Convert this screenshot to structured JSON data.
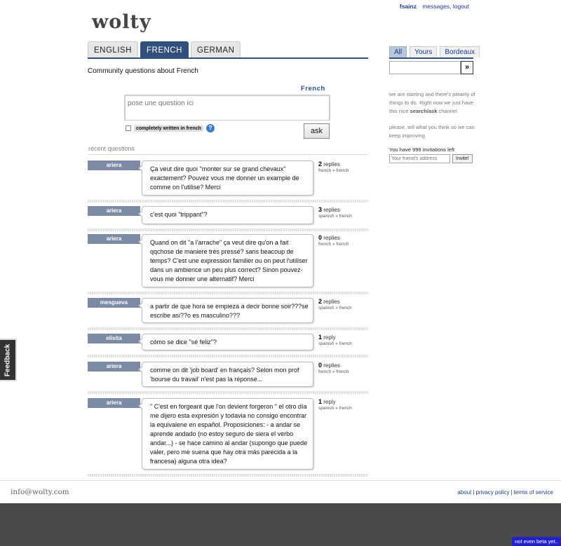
{
  "header": {
    "user": "fsainz",
    "messages_link": "messages",
    "logout_link": "logout",
    "logo": "wolty"
  },
  "tabs": [
    {
      "label": "ENGLISH",
      "active": false
    },
    {
      "label": "FRENCH",
      "active": true
    },
    {
      "label": "GERMAN",
      "active": false
    }
  ],
  "sidebar": {
    "tabs": [
      {
        "label": "All",
        "active": true
      },
      {
        "label": "Yours",
        "active": false
      },
      {
        "label": "Bordeaux",
        "active": false
      }
    ],
    "search_button": "»",
    "intro_text_1": "we are starting and there's pleanty of things to do. Right now we just have this nice ",
    "intro_highlight": "search/ask",
    "intro_text_2": " channel",
    "feedback_text": "please, tell what you think so we can keep improving",
    "invitations_text": "You have 998 invitations left",
    "invite_placeholder": "Your friend's address",
    "invite_button": "Invite!"
  },
  "main": {
    "title": "Community questions about French",
    "language_label": "French",
    "question_placeholder": "pose une question ici",
    "written_label": "completely written in french",
    "help_icon": "?",
    "ask_button": "ask",
    "recent_label": "recent questions"
  },
  "questions": [
    {
      "user": "ariera",
      "text": "Ça veut dire quoi \"monter sur se grand chevaux\" exactement? Pouvez vous me donner un example de comme on l'utilise? Merci",
      "replies": "2",
      "replies_label": "replies",
      "pair": "french » french"
    },
    {
      "user": "ariera",
      "text": "c'est quoi \"trippant\"?",
      "replies": "3",
      "replies_label": "replies",
      "pair": "spanish » french"
    },
    {
      "user": "ariera",
      "text": "Quand on dit \"a l'arrache\" ça veut dire qu'on a fait qqchose de maniere très pressé? sans beacoup de temps? C'est une expression familier ou on peut l'utiliser dans un ambience un peu plus correct? Sinon pouvez-vous me donner une alternatif? Merci",
      "replies": "0",
      "replies_label": "replies",
      "pair": "french » french"
    },
    {
      "user": "mesgueva",
      "text": "a partir de que hora se empieza a decir bonne soir???se escribe asi??o es masculino???",
      "replies": "2",
      "replies_label": "replies",
      "pair": "spanish » french"
    },
    {
      "user": "elisita",
      "text": "cómo se dice \"sé feliz\"?",
      "replies": "1",
      "replies_label": "reply",
      "pair": "spanish » french"
    },
    {
      "user": "ariera",
      "text": "comme on dit 'job board' en français? Selon mon prof 'bourse du travail' n'est pas la réponse...",
      "replies": "0",
      "replies_label": "replies",
      "pair": "french » french"
    },
    {
      "user": "ariera",
      "text": "\" C'est en forgeant que l'on devient forgeron \" el otro día me dijero esta expresión y todavia no consigo encontrar la equivalene en español. Proposiciones: - a andar se aprende andado (no estoy seguro de siera el verbo andar...) - se hace camino al andar (supongo que puede valer, pero me suena que hay otra más parecida a la francesa) alguna otra idea?",
      "replies": "1",
      "replies_label": "reply",
      "pair": "spanish » french"
    }
  ],
  "footer": {
    "email": "info@wolty.com",
    "about": "about",
    "privacy": "privacy policy",
    "terms": "terms of service",
    "separator": "|",
    "beta": "not even beta yet..",
    "feedback_tab": "Feedback"
  }
}
